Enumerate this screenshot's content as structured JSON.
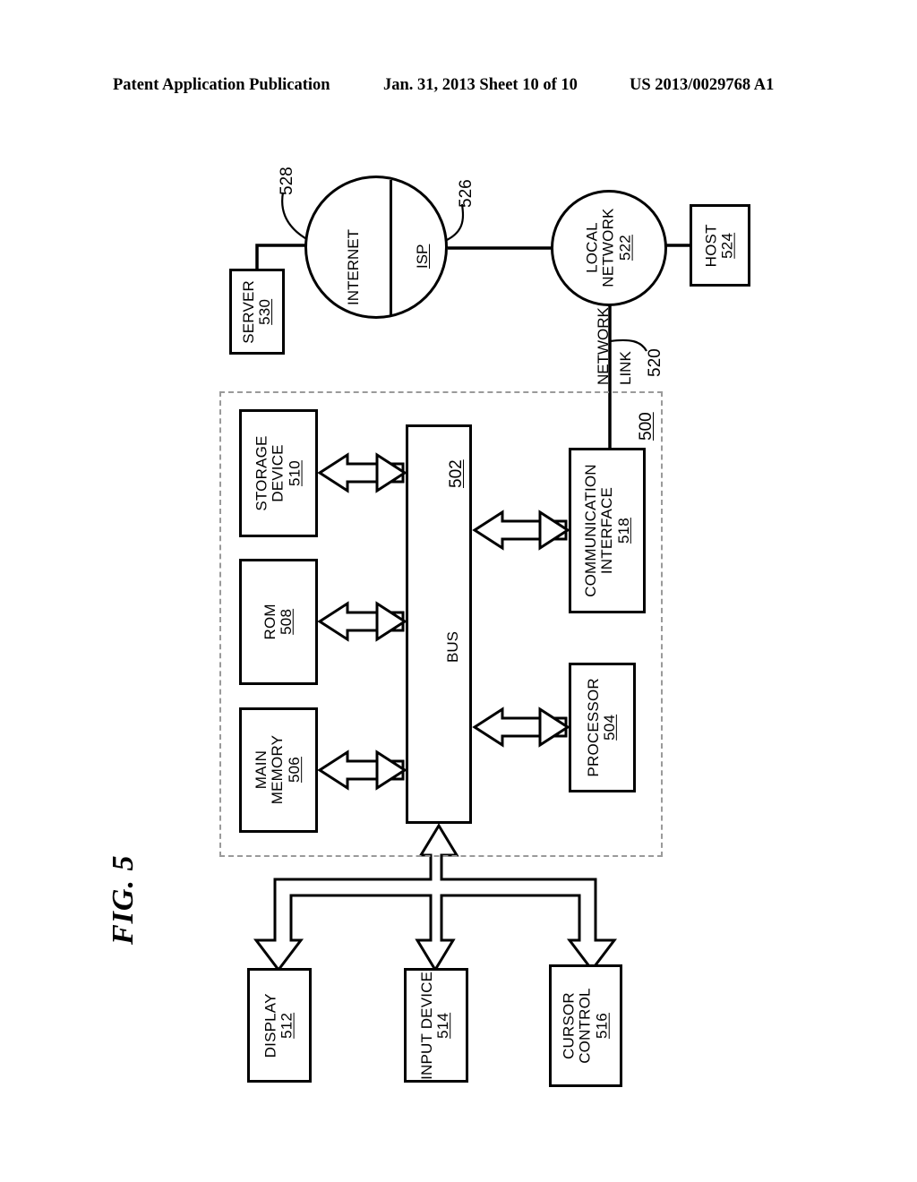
{
  "header": {
    "publication": "Patent Application Publication",
    "date_sheet": "Jan. 31, 2013   Sheet 10 of 10",
    "patent_number": "US 2013/0029768 A1"
  },
  "figure": {
    "label": "FIG. 5",
    "system_ref": "500"
  },
  "network": {
    "internet": {
      "label": "INTERNET",
      "ref": "528"
    },
    "isp": {
      "label": "ISP",
      "ref": "526"
    },
    "server": {
      "label": "SERVER",
      "ref": "530"
    },
    "local_network": {
      "label_line1": "LOCAL",
      "label_line2": "NETWORK",
      "ref": "522"
    },
    "host": {
      "label": "HOST",
      "ref": "524"
    },
    "network_link": {
      "label_line1": "NETWORK",
      "label_line2": "LINK",
      "ref": "520"
    }
  },
  "computer_system": {
    "storage_device": {
      "label_line1": "STORAGE",
      "label_line2": "DEVICE",
      "ref": "510"
    },
    "rom": {
      "label": "ROM",
      "ref": "508"
    },
    "main_memory": {
      "label_line1": "MAIN",
      "label_line2": "MEMORY",
      "ref": "506"
    },
    "bus": {
      "label": "BUS",
      "ref": "502"
    },
    "communication_interface": {
      "label_line1": "COMMUNICATION",
      "label_line2": "INTERFACE",
      "ref": "518"
    },
    "processor": {
      "label": "PROCESSOR",
      "ref": "504"
    }
  },
  "peripherals": {
    "display": {
      "label": "DISPLAY",
      "ref": "512"
    },
    "input_device": {
      "label": "INPUT DEVICE",
      "ref": "514"
    },
    "cursor_control": {
      "label_line1": "CURSOR",
      "label_line2": "CONTROL",
      "ref": "516"
    }
  }
}
